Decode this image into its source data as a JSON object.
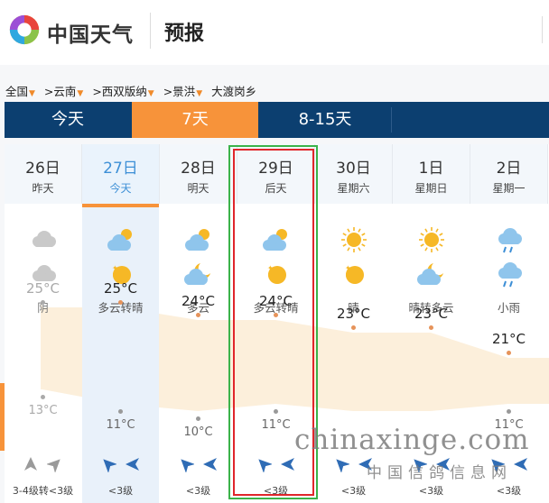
{
  "header": {
    "brand": "中国天气",
    "section": "预报"
  },
  "breadcrumb": [
    "全国",
    ">云南",
    ">西双版纳",
    ">景洪",
    "大渡岗乡"
  ],
  "tabs": [
    "今天",
    "7天",
    "8-15天"
  ],
  "active_tab": "7天",
  "days": [
    {
      "date": "26日",
      "sub": "昨天",
      "day_icon": "overcast-icon",
      "night_icon": "overcast-icon",
      "condition": "阴",
      "high": "25°C",
      "low": "13°C",
      "high_value": 25,
      "low_value": 13,
      "wind": "3-4级转<3级",
      "state": "past"
    },
    {
      "date": "27日",
      "sub": "今天",
      "day_icon": "partly-cloudy-icon",
      "night_icon": "clear-night-icon",
      "condition": "多云转晴",
      "high": "25°C",
      "low": "11°C",
      "high_value": 25,
      "low_value": 11,
      "wind": "<3级",
      "state": "today"
    },
    {
      "date": "28日",
      "sub": "明天",
      "day_icon": "partly-cloudy-icon",
      "night_icon": "cloudy-night-icon",
      "condition": "多云",
      "high": "24°C",
      "low": "10°C",
      "high_value": 24,
      "low_value": 10,
      "wind": "<3级",
      "state": "future"
    },
    {
      "date": "29日",
      "sub": "后天",
      "day_icon": "partly-cloudy-icon",
      "night_icon": "clear-night-icon",
      "condition": "多云转晴",
      "high": "24°C",
      "low": "11°C",
      "high_value": 24,
      "low_value": 11,
      "wind": "<3级",
      "state": "future"
    },
    {
      "date": "30日",
      "sub": "星期六",
      "day_icon": "sunny-icon",
      "night_icon": "clear-night-icon",
      "condition": "晴",
      "high": "23°C",
      "low": "",
      "high_value": 23,
      "low_value": null,
      "wind": "<3级",
      "state": "future"
    },
    {
      "date": "1日",
      "sub": "星期日",
      "day_icon": "sunny-icon",
      "night_icon": "cloudy-night-icon",
      "condition": "晴转多云",
      "high": "23°C",
      "low": "",
      "high_value": 23,
      "low_value": null,
      "wind": "<3级",
      "state": "future"
    },
    {
      "date": "2日",
      "sub": "星期一",
      "day_icon": "rain-icon",
      "night_icon": "rain-icon",
      "condition": "小雨",
      "high": "21°C",
      "low": "11°C",
      "high_value": 21,
      "low_value": 11,
      "wind": "<3级",
      "state": "future"
    }
  ],
  "watermark": {
    "text": "chinaxinge.com",
    "subtext": "中国信鸽信息网"
  },
  "colors": {
    "accent": "#f7933a",
    "navy": "#0c3f70",
    "today_text": "#3d8fd6",
    "highlight_green": "#3bb34a",
    "highlight_red": "#e0262b"
  }
}
